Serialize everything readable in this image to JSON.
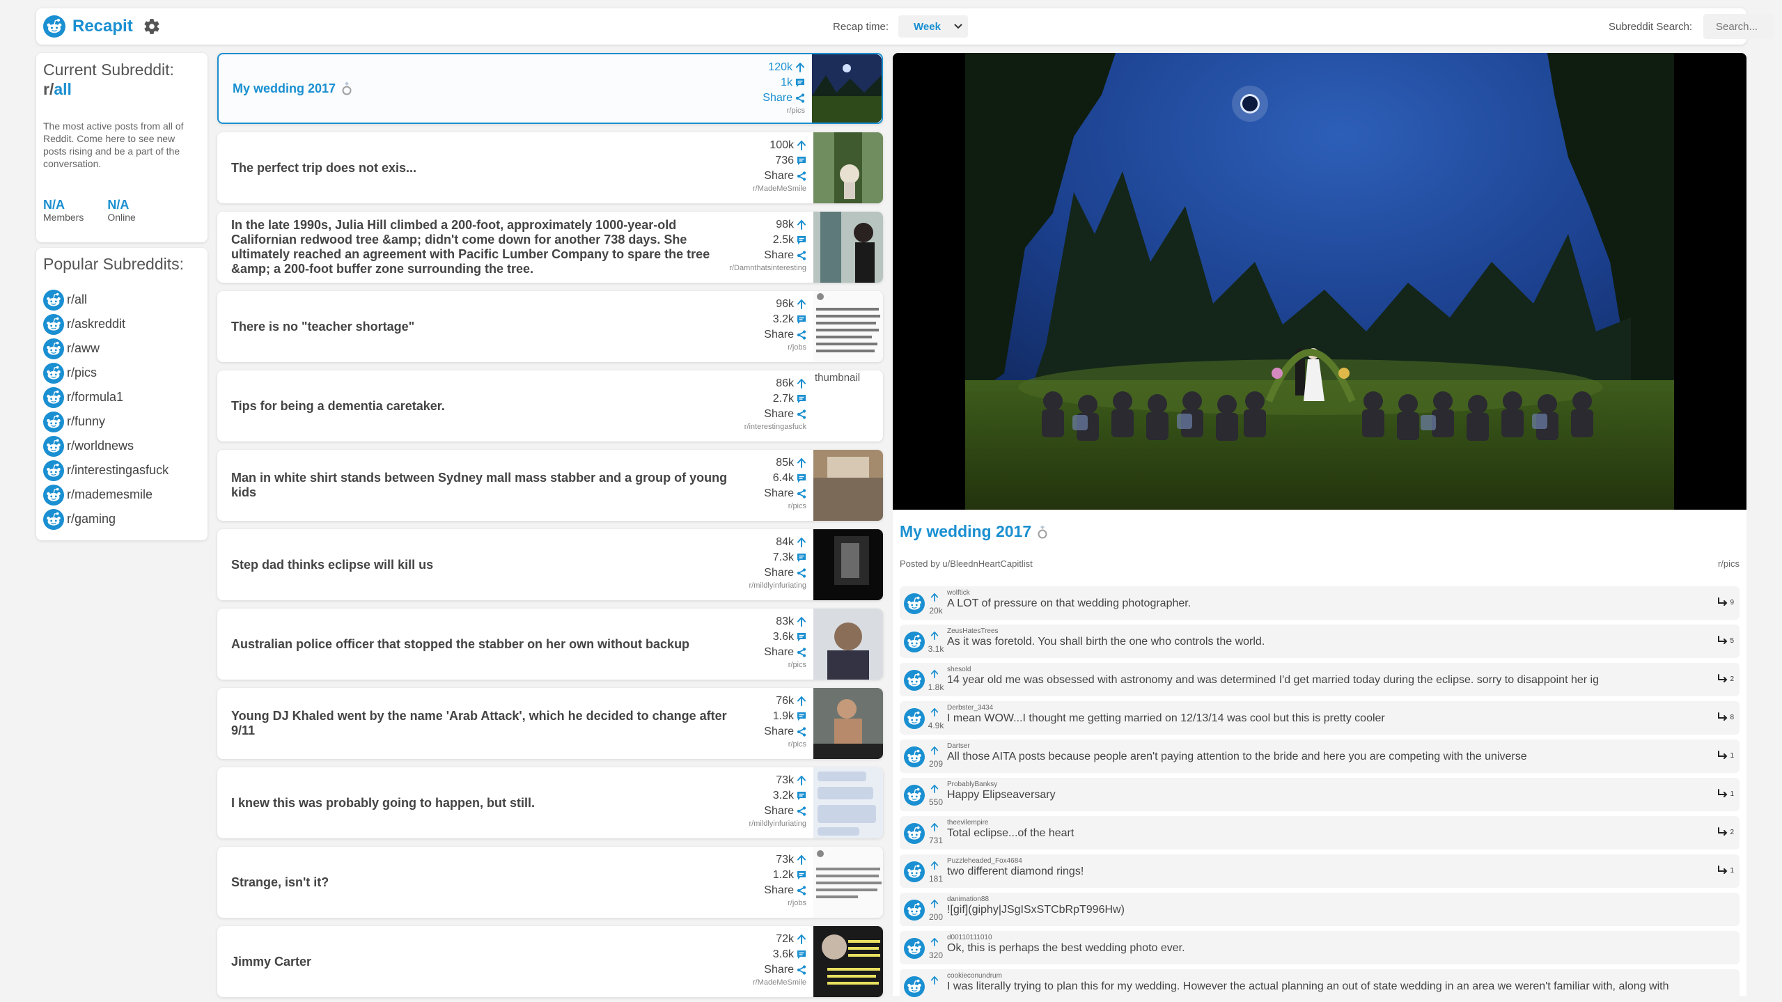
{
  "header": {
    "brand": "Recapit",
    "recap_label": "Recap time:",
    "recap_value": "Week",
    "search_label": "Subreddit Search:",
    "search_placeholder": "Search..."
  },
  "current": {
    "heading": "Current Subreddit:",
    "prefix": "r/",
    "name": "all",
    "description": "The most active posts from all of Reddit. Come here to see new posts rising and be a part of the conversation.",
    "members_value": "N/A",
    "members_label": "Members",
    "online_value": "N/A",
    "online_label": "Online"
  },
  "popular": {
    "heading": "Popular Subreddits:",
    "items": [
      "r/all",
      "r/askreddit",
      "r/aww",
      "r/pics",
      "r/formula1",
      "r/funny",
      "r/worldnews",
      "r/interestingasfuck",
      "r/mademesmile",
      "r/gaming"
    ]
  },
  "share_label": "Share",
  "posts": [
    {
      "title": "My wedding 2017",
      "upvotes": "120k",
      "comments": "1k",
      "subreddit": "r/pics"
    },
    {
      "title": "The perfect trip does not exis...",
      "upvotes": "100k",
      "comments": "736",
      "subreddit": "r/MadeMeSmile"
    },
    {
      "title": "In the late 1990s, Julia Hill climbed a 200-foot, approximately 1000-year-old Californian redwood tree &amp; didn't come down for another 738 days. She ultimately reached an agreement with Pacific Lumber Company to spare the tree &amp; a 200-foot buffer zone surrounding the tree.",
      "upvotes": "98k",
      "comments": "2.5k",
      "subreddit": "r/Damnthatsinteresting"
    },
    {
      "title": "There is no \"teacher shortage\"",
      "upvotes": "96k",
      "comments": "3.2k",
      "subreddit": "r/jobs"
    },
    {
      "title": "Tips for being a dementia caretaker.",
      "upvotes": "86k",
      "comments": "2.7k",
      "subreddit": "r/interestingasfuck",
      "thumb_alt": "thumbnail"
    },
    {
      "title": "Man in white shirt stands between Sydney mall mass stabber and a group of young kids",
      "upvotes": "85k",
      "comments": "6.4k",
      "subreddit": "r/pics"
    },
    {
      "title": "Step dad thinks eclipse will kill us",
      "upvotes": "84k",
      "comments": "7.3k",
      "subreddit": "r/mildlyinfuriating"
    },
    {
      "title": "Australian police officer that stopped the stabber on her own without backup",
      "upvotes": "83k",
      "comments": "3.6k",
      "subreddit": "r/pics"
    },
    {
      "title": "Young DJ Khaled went by the name 'Arab Attack', which he decided to change after 9/11",
      "upvotes": "76k",
      "comments": "1.9k",
      "subreddit": "r/pics"
    },
    {
      "title": "I knew this was probably going to happen, but still.",
      "upvotes": "73k",
      "comments": "3.2k",
      "subreddit": "r/mildlyinfuriating"
    },
    {
      "title": "Strange, isn't it?",
      "upvotes": "73k",
      "comments": "1.2k",
      "subreddit": "r/jobs"
    },
    {
      "title": "Jimmy Carter",
      "upvotes": "72k",
      "comments": "3.6k",
      "subreddit": "r/MadeMeSmile"
    }
  ],
  "detail": {
    "title": "My wedding 2017",
    "posted_by": "Posted by u/BleednHeartCapitlist",
    "subreddit": "r/pics"
  },
  "comments": [
    {
      "user": "wolftick",
      "score": "20k",
      "text": "A LOT of pressure on that wedding photographer.",
      "replies": "9"
    },
    {
      "user": "ZeusHatesTrees",
      "score": "3.1k",
      "text": "As it was foretold. You shall birth the one who controls the world.",
      "replies": "5"
    },
    {
      "user": "shesold",
      "score": "1.8k",
      "text": "14 year old me was obsessed with astronomy and was determined I'd get married today during the eclipse. sorry to disappoint her ig",
      "replies": "2"
    },
    {
      "user": "Derbster_3434",
      "score": "4.9k",
      "text": "I mean WOW...I thought me getting married on 12/13/14 was cool but this is pretty cooler",
      "replies": "8"
    },
    {
      "user": "Dartser",
      "score": "209",
      "text": "All those AITA posts because people aren't paying attention to the bride and here you are competing with the universe",
      "replies": "1"
    },
    {
      "user": "ProbablyBanksy",
      "score": "550",
      "text": "Happy Elipseaversary",
      "replies": "1"
    },
    {
      "user": "theevilempire",
      "score": "731",
      "text": "Total eclipse...of the heart",
      "replies": "2"
    },
    {
      "user": "Puzzleheaded_Fox4684",
      "score": "181",
      "text": "two different diamond rings!",
      "replies": "1"
    },
    {
      "user": "danimation88",
      "score": "200",
      "text": "![gif](giphy|JSgISxSTCbRpT996Hw)",
      "replies": ""
    },
    {
      "user": "d00110111010",
      "score": "320",
      "text": "Ok, this is perhaps the best wedding photo ever.",
      "replies": ""
    },
    {
      "user": "cookieconundrum",
      "score": "",
      "text": "I was literally trying to plan this for my wedding. However the actual planning an out of state wedding in an area we weren't familiar with, along with",
      "replies": ""
    }
  ],
  "colors": {
    "accent": "#1a8fd1",
    "background": "#f3f3f3"
  }
}
